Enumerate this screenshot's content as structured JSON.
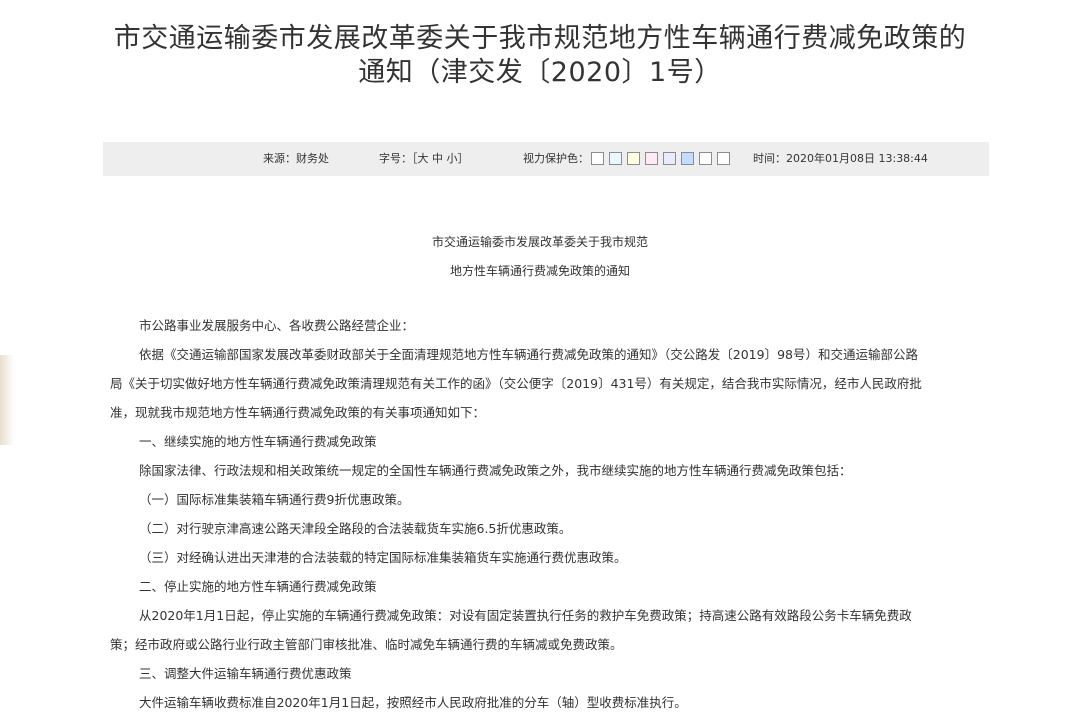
{
  "header": {
    "title_line1": "市交通运输委市发展改革委关于我市规范地方性车辆通行费减免政策的",
    "title_line2": "通知（津交发〔2020〕1号）"
  },
  "infobar": {
    "source": "来源：财务处",
    "font_label": "字号：",
    "font_bracket_open": "［",
    "font_large": "大",
    "font_medium": "中",
    "font_small": "小",
    "font_bracket_close": "］",
    "eye_label": "视力保护色：",
    "eye_colors": [
      "#FFFFFF",
      "#EAF7FF",
      "#FFFFE1",
      "#FFE9F5",
      "#E9E9FF",
      "#C5DCFF",
      "#FFFFFF",
      "#FFFFFF"
    ],
    "time": "时间：2020年01月08日 13:38:44"
  },
  "doc": {
    "subtitle_line1": "市交通运输委市发展改革委关于我市规范",
    "subtitle_line2": "地方性车辆通行费减免政策的通知",
    "paragraphs": [
      "市公路事业发展服务中心、各收费公路经营企业：",
      "依据《交通运输部国家发展改革委财政部关于全面清理规范地方性车辆通行费减免政策的通知》（交公路发〔2019〕98号）和交通运输部公路",
      "局《关于切实做好地方性车辆通行费减免政策清理规范有关工作的函》（交公便字〔2019〕431号）有关规定，结合我市实际情况，经市人民政府批",
      "准，现就我市规范地方性车辆通行费减免政策的有关事项通知如下：",
      "一、继续实施的地方性车辆通行费减免政策",
      "除国家法律、行政法规和相关政策统一规定的全国性车辆通行费减免政策之外，我市继续实施的地方性车辆通行费减免政策包括：",
      "（一）国际标准集装箱车辆通行费9折优惠政策。",
      "（二）对行驶京津高速公路天津段全路段的合法装载货车实施6.5折优惠政策。",
      "（三）对经确认进出天津港的合法装载的特定国际标准集装箱货车实施通行费优惠政策。",
      "二、停止实施的地方性车辆通行费减免政策",
      "从2020年1月1日起，停止实施的车辆通行费减免政策：对设有固定装置执行任务的救护车免费政策；持高速公路有效路段公务卡车辆免费政",
      "策；经市政府或公路行业行政主管部门审核批准、临时减免车辆通行费的车辆减或免费政策。",
      "三、调整大件运输车辆通行费优惠政策",
      "大件运输车辆收费标准自2020年1月1日起，按照经市人民政府批准的分车（轴）型收费标准执行。"
    ]
  }
}
